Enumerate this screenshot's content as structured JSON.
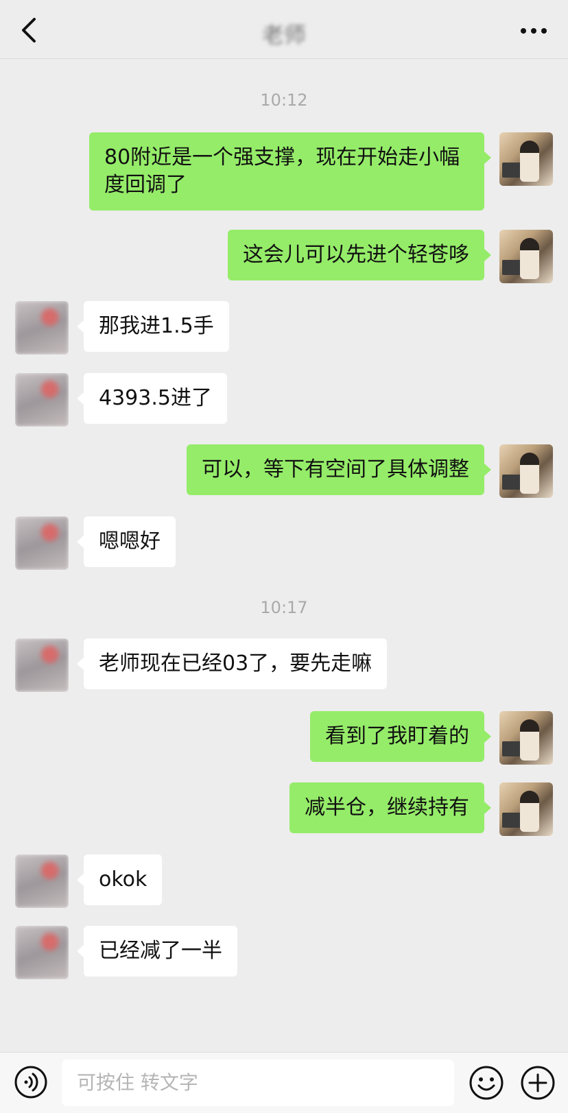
{
  "header": {
    "title": "老师",
    "back_icon": "chevron-left-icon",
    "more_icon": "more-dots-icon"
  },
  "messages": [
    {
      "type": "time",
      "text": "10:12"
    },
    {
      "type": "msg",
      "side": "me",
      "text": "80附近是一个强支撑，现在开始走小幅度回调了"
    },
    {
      "type": "msg",
      "side": "me",
      "text": "这会儿可以先进个轻苍哆"
    },
    {
      "type": "msg",
      "side": "other",
      "text": "那我进1.5手"
    },
    {
      "type": "msg",
      "side": "other",
      "text": "4393.5进了"
    },
    {
      "type": "msg",
      "side": "me",
      "text": "可以，等下有空间了具体调整"
    },
    {
      "type": "msg",
      "side": "other",
      "text": "嗯嗯好"
    },
    {
      "type": "time",
      "text": "10:17"
    },
    {
      "type": "msg",
      "side": "other",
      "text": "老师现在已经03了，要先走嘛"
    },
    {
      "type": "msg",
      "side": "me",
      "text": "看到了我盯着的"
    },
    {
      "type": "msg",
      "side": "me",
      "text": "减半仓，继续持有"
    },
    {
      "type": "msg",
      "side": "other",
      "text": "okok"
    },
    {
      "type": "msg",
      "side": "other",
      "text": "已经减了一半"
    }
  ],
  "input": {
    "placeholder": "可按住 转文字",
    "voice_icon": "voice-icon",
    "emoji_icon": "emoji-icon",
    "plus_icon": "plus-icon"
  },
  "colors": {
    "my_bubble": "#95ec69",
    "other_bubble": "#ffffff",
    "background": "#ededed"
  }
}
